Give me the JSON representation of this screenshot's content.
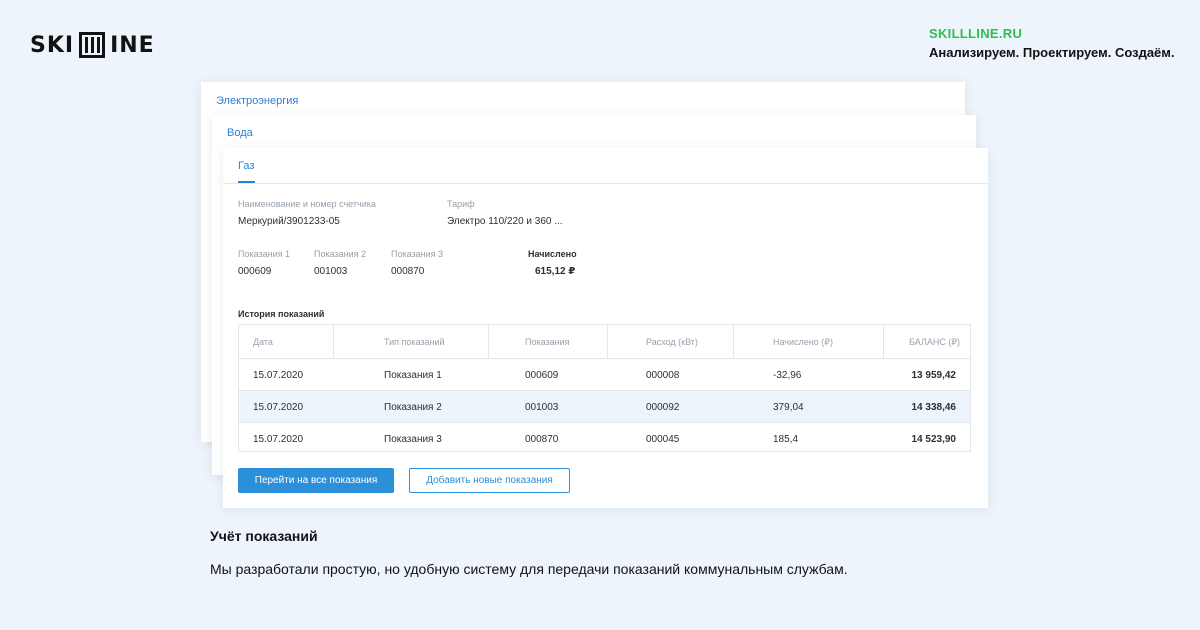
{
  "header": {
    "logo_left": "SKI",
    "logo_right": "INE",
    "site": "SKILLLINE.RU",
    "tagline": "Анализируем. Проектируем. Создаём."
  },
  "tabs": {
    "back1": "Электроэнергия",
    "back2": "Вода",
    "active": "Газ"
  },
  "meter": {
    "name_label": "Наименование и номер счетчика",
    "name_value": "Меркурий/3901233-05",
    "tariff_label": "Тариф",
    "tariff_value": "Электро 110/220 и 360 ..."
  },
  "readings": [
    {
      "label": "Показания 1",
      "value": "000609"
    },
    {
      "label": "Показания 2",
      "value": "001003"
    },
    {
      "label": "Показания 3",
      "value": "000870"
    }
  ],
  "charged": {
    "label": "Начислено",
    "value": "615,12 ₽"
  },
  "history": {
    "title": "История показаний",
    "columns": [
      "Дата",
      "Тип показаний",
      "Показания",
      "Расход (кВт)",
      "Начислено (₽)",
      "БАЛАНС (₽)"
    ],
    "rows": [
      [
        "15.07.2020",
        "Показания 1",
        "000609",
        "000008",
        "-32,96",
        "13 959,42"
      ],
      [
        "15.07.2020",
        "Показания 2",
        "001003",
        "000092",
        "379,04",
        "14 338,46"
      ],
      [
        "15.07.2020",
        "Показания 3",
        "000870",
        "000045",
        "185,4",
        "14 523,90"
      ]
    ]
  },
  "buttons": {
    "primary": "Перейти на все показания",
    "secondary": "Добавить новые показания"
  },
  "section": {
    "title": "Учёт показаний",
    "description": "Мы разработали простую, но удобную систему для передачи показаний коммунальным службам."
  },
  "colors": {
    "accent": "#2b8fd9",
    "brand_green": "#2bbf52",
    "background": "#eef4fb"
  }
}
